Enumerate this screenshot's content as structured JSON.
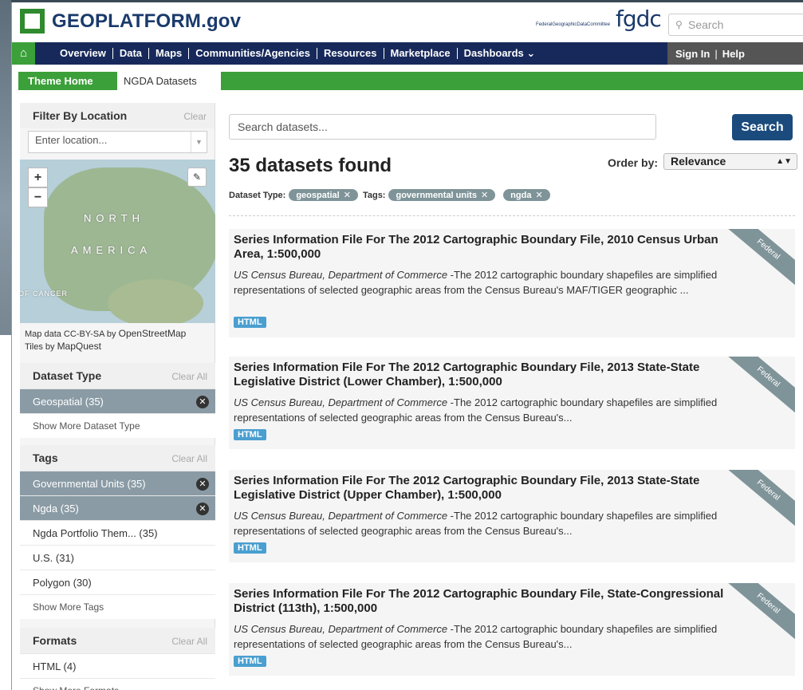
{
  "header": {
    "logo_text": "GEOPLATFORM.gov",
    "fgdc_small": "FederalGeographicDataCommittee",
    "fgdc_big": "fgdc",
    "search_placeholder": "Search",
    "search_icon": "magnifier-icon"
  },
  "nav": {
    "home_icon": "home-icon",
    "items": [
      "Overview",
      "Data",
      "Maps",
      "Communities/Agencies",
      "Resources",
      "Marketplace",
      "Dashboards"
    ],
    "dashboards_caret": "⌄",
    "sign_in": "Sign In",
    "help": "Help"
  },
  "theme": {
    "home": "Theme Home",
    "current": "NGDA Datasets"
  },
  "sidebar": {
    "location": {
      "title": "Filter By Location",
      "clear": "Clear",
      "placeholder": "Enter location...",
      "map_labels": [
        "NORTH",
        "AMERICA",
        "OF CANCER"
      ],
      "attr_line1_prefix": "Map data CC-BY-SA by",
      "attr_line1_link": "OpenStreetMap",
      "attr_line2_prefix": "Tiles by",
      "attr_line2_link": "MapQuest"
    },
    "dataset_type": {
      "title": "Dataset Type",
      "clear": "Clear All",
      "items": [
        {
          "label": "Geospatial (35)",
          "active": true
        }
      ],
      "more": "Show More Dataset Type"
    },
    "tags": {
      "title": "Tags",
      "clear": "Clear All",
      "items": [
        {
          "label": "Governmental Units (35)",
          "active": true
        },
        {
          "label": "Ngda (35)",
          "active": true
        },
        {
          "label": "Ngda Portfolio Them... (35)",
          "active": false
        },
        {
          "label": "U.S. (31)",
          "active": false
        },
        {
          "label": "Polygon (30)",
          "active": false
        }
      ],
      "more": "Show More Tags"
    },
    "formats": {
      "title": "Formats",
      "clear": "Clear All",
      "items": [
        {
          "label": "HTML (4)",
          "active": false
        }
      ],
      "more": "Show More Formats"
    }
  },
  "main": {
    "search_placeholder": "Search datasets...",
    "search_button": "Search",
    "found": "35 datasets found",
    "order_label": "Order by:",
    "order_value": "Relevance",
    "filters": {
      "type_label": "Dataset Type:",
      "type_pill": "geospatial",
      "tags_label": "Tags:",
      "tag_pills": [
        "governmental units",
        "ngda"
      ]
    },
    "results": [
      {
        "title": "Series Information File For The 2012 Cartographic Boundary File, 2010 Census Urban Area, 1:500,000",
        "publisher": "US Census Bureau, Department of Commerce",
        "desc": " -The 2012 cartographic boundary shapefiles are simplified representations of selected geographic areas from the Census Bureau's MAF/TIGER geographic ...",
        "format": "HTML",
        "ribbon": "Federal"
      },
      {
        "title": "Series Information File For The 2012 Cartographic Boundary File, 2013 State-State Legislative District (Lower Chamber), 1:500,000",
        "publisher": "US Census Bureau, Department of Commerce",
        "desc": " -The 2012 cartographic boundary shapefiles are simplified representations of selected geographic areas from the Census Bureau's...",
        "format": "HTML",
        "ribbon": "Federal"
      },
      {
        "title": "Series Information File For The 2012 Cartographic Boundary File, 2013 State-State Legislative District (Upper Chamber), 1:500,000",
        "publisher": "US Census Bureau, Department of Commerce",
        "desc": " -The 2012 cartographic boundary shapefiles are simplified representations of selected geographic areas from the Census Bureau's...",
        "format": "HTML",
        "ribbon": "Federal"
      },
      {
        "title": "Series Information File For The 2012 Cartographic Boundary File, State-Congressional District (113th), 1:500,000",
        "publisher": "US Census Bureau, Department of Commerce",
        "desc": " -The 2012 cartographic boundary shapefiles are simplified representations of selected geographic areas from the Census Bureau's...",
        "format": "HTML",
        "ribbon": "Federal"
      }
    ]
  },
  "colors": {
    "brand_green": "#3ca03a",
    "nav_navy": "#17295b",
    "search_button": "#1b4b7c",
    "pill_gray": "#7f9499",
    "format_badge": "#4a9fd0"
  }
}
